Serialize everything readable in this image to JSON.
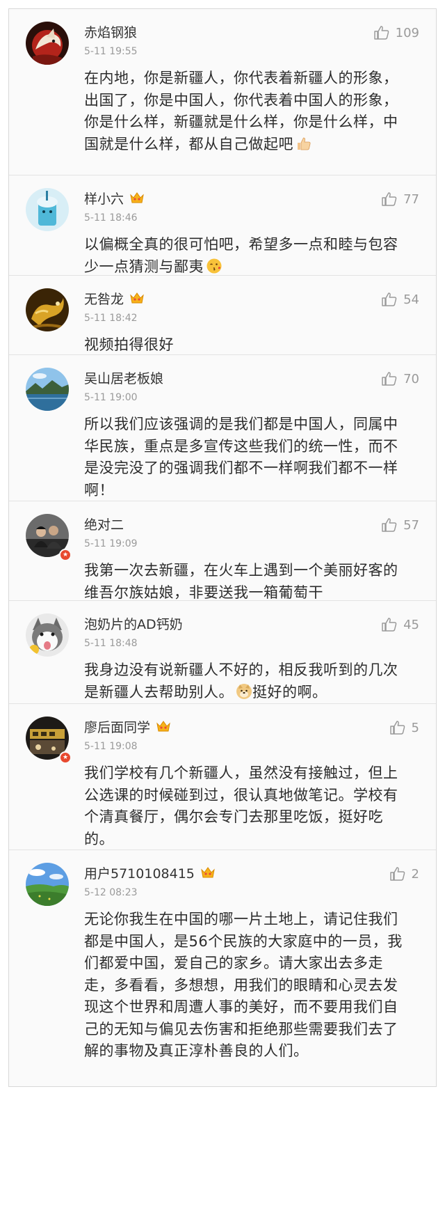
{
  "comments": [
    {
      "username": "赤焰钢狼",
      "time": "5-11 19:55",
      "likes": "109",
      "text": "在内地，你是新疆人，你代表着新疆人的形象，出国了，你是中国人，你代表着中国人的形象，你是什么样，新疆就是什么样，你是什么样，中国就是什么样，都从自己做起吧",
      "emoji": "thumbs-up-emoji",
      "avatar": "red-wolf-avatar",
      "vip": false,
      "badge": false
    },
    {
      "username": "样小六",
      "time": "5-11 18:46",
      "likes": "77",
      "text": "以偏概全真的很可怕吧，希望多一点和睦与包容少一点猜测与鄙夷",
      "emoji": "kiss-face-emoji",
      "avatar": "blue-drink-avatar",
      "vip": true,
      "badge": false
    },
    {
      "username": "无咎龙",
      "time": "5-11 18:42",
      "likes": "54",
      "text": "视频拍得很好",
      "emoji": "",
      "avatar": "golden-dragon-avatar",
      "vip": true,
      "badge": false
    },
    {
      "username": "吴山居老板娘",
      "time": "5-11 19:00",
      "likes": "70",
      "text": "所以我们应该强调的是我们都是中国人，同属中华民族，重点是多宣传这些我们的统一性，而不是没完没了的强调我们都不一样啊我们都不一样啊！",
      "emoji": "",
      "avatar": "mountain-lake-avatar",
      "vip": false,
      "badge": false
    },
    {
      "username": "绝对二",
      "time": "5-11 19:09",
      "likes": "57",
      "text": "我第一次去新疆，在火车上遇到一个美丽好客的维吾尔族姑娘，非要送我一箱葡萄干",
      "emoji": "",
      "avatar": "couple-photo-avatar",
      "vip": false,
      "badge": true
    },
    {
      "username": "泡奶片的AD钙奶",
      "time": "5-11 18:48",
      "likes": "45",
      "text_before": "我身边没有说新疆人不好的，相反我听到的几次是新疆人去帮助别人。",
      "text_after": "挺好的啊。",
      "emoji": "doge-emoji",
      "avatar": "husky-dog-avatar",
      "vip": false,
      "badge": false
    },
    {
      "username": "廖后面同学",
      "time": "5-11 19:08",
      "likes": "5",
      "text": "我们学校有几个新疆人，虽然没有接触过，但上公选课的时候碰到过，很认真地做笔记。学校有个清真餐厅，偶尔会专门去那里吃饭，挺好吃的。",
      "emoji": "",
      "avatar": "night-street-avatar",
      "vip": true,
      "badge": true
    },
    {
      "username": "用户5710108415",
      "time": "5-12 08:23",
      "likes": "2",
      "text": "无论你我生在中国的哪一片土地上，请记住我们都是中国人，是56个民族的大家庭中的一员，我们都爱中国，爱自己的家乡。请大家出去多走走，多看看，多想想，用我们的眼睛和心灵去发现这个世界和周遭人事的美好，而不要用我们自己的无知与偏见去伤害和拒绝那些需要我们去了解的事物及真正淳朴善良的人们。",
      "emoji": "",
      "avatar": "grassland-avatar",
      "vip": true,
      "badge": false
    }
  ]
}
